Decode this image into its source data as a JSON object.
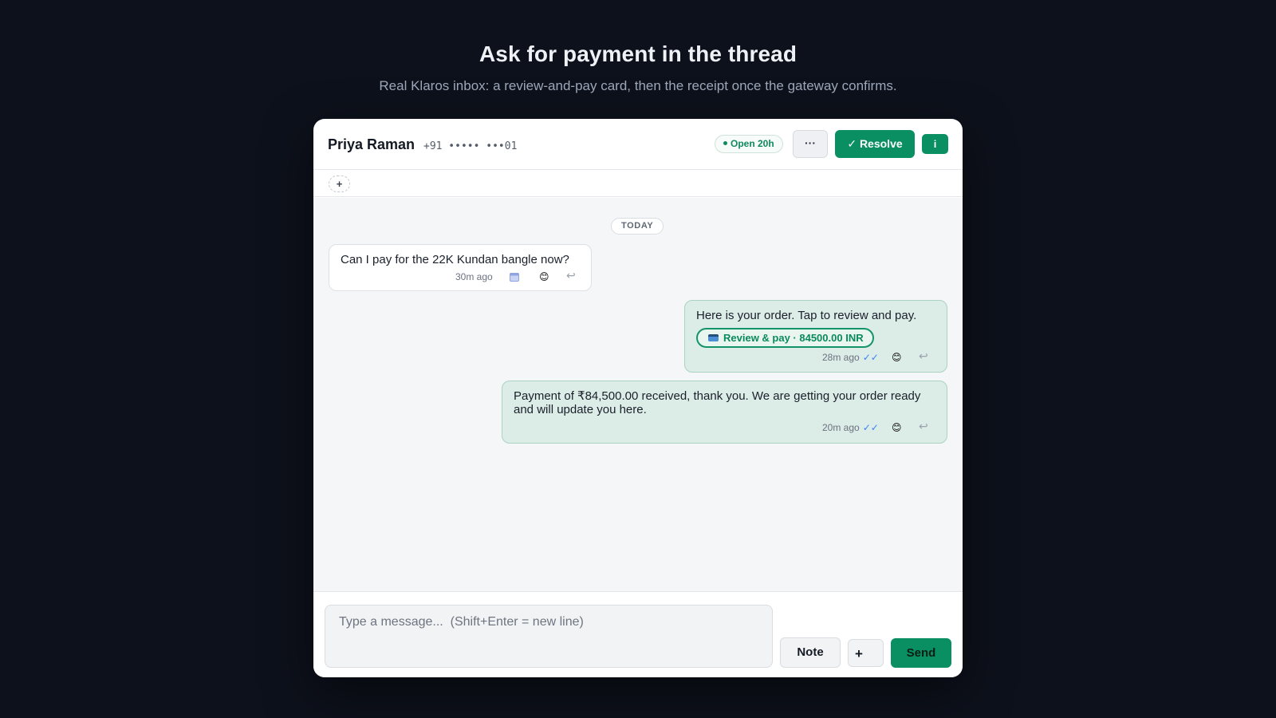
{
  "page": {
    "title": "Ask for payment in the thread",
    "subtitle": "Real Klaros inbox: a review-and-pay card, then the receipt once the gateway confirms."
  },
  "header": {
    "contact_name": "Priya Raman",
    "contact_phone": "+91 ••••• •••01",
    "status": "Open 20h",
    "more_label": "···",
    "resolve_label": "✓ Resolve",
    "info_label": "i"
  },
  "tags": {
    "add_label": "+"
  },
  "thread": {
    "day_label": "TODAY",
    "messages": [
      {
        "direction": "incoming",
        "text": "Can I pay for the 22K Kundan bangle now?",
        "time": "30m ago",
        "icons": [
          "calendar-icon",
          "emoji-icon",
          "reply-icon"
        ]
      },
      {
        "direction": "outgoing",
        "text": "Here is your order. Tap to review and pay.",
        "pay_chip": "Review & pay · 84500.00 INR",
        "time": "28m ago",
        "ticks": "✓✓",
        "icons": [
          "read-ticks-icon",
          "emoji-icon",
          "reply-icon"
        ]
      },
      {
        "direction": "outgoing",
        "text": "Payment of ₹84,500.00 received, thank you. We are getting your order ready and will update you here.",
        "time": "20m ago",
        "ticks": "✓✓",
        "icons": [
          "read-ticks-icon",
          "emoji-icon",
          "reply-icon"
        ]
      }
    ]
  },
  "composer": {
    "placeholder": "Type a message...  (Shift+Enter = new line)",
    "value": "",
    "note_label": "Note",
    "attach_label": "+",
    "send_label": "Send"
  },
  "colors": {
    "background": "#0d111b",
    "accent": "#0a8f62",
    "outgoing_bubble": "#dcece6",
    "read_ticks": "#3b82f6"
  }
}
